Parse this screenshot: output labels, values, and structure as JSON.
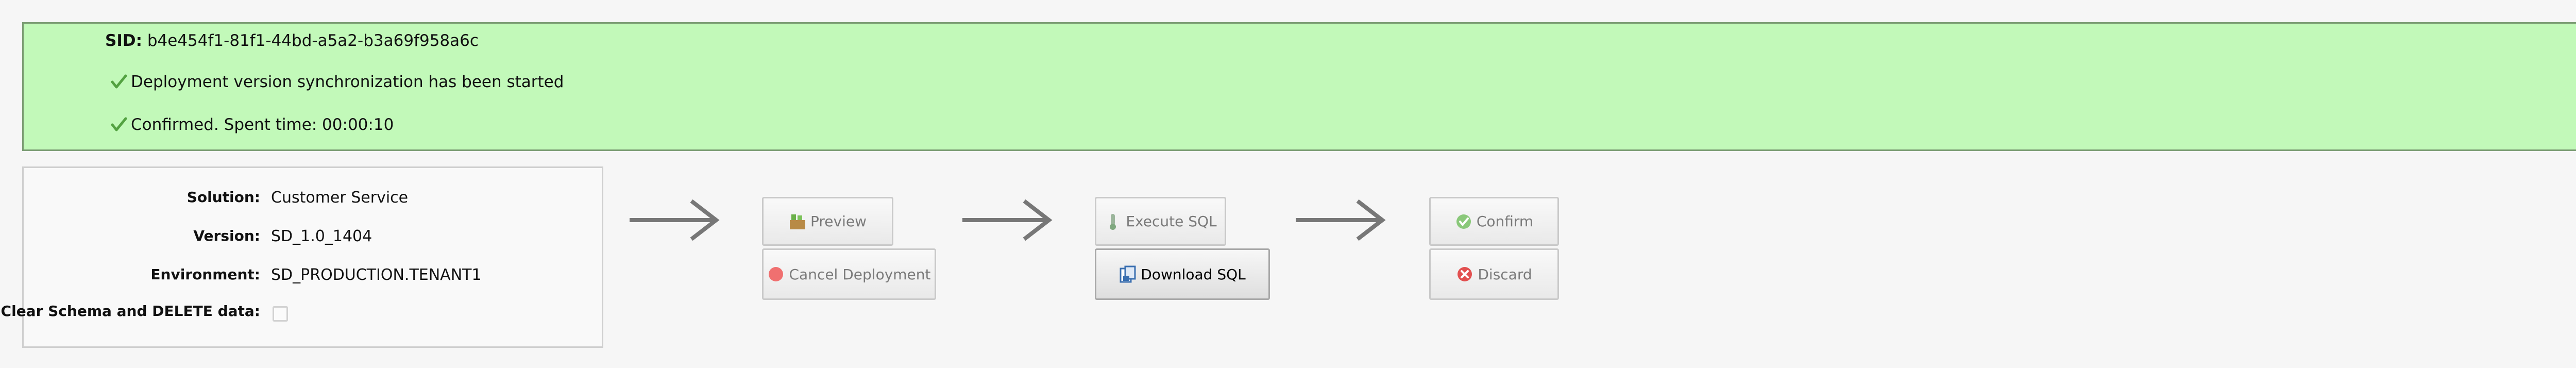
{
  "banner": {
    "sid_label": "SID:",
    "sid_value": "b4e454f1-81f1-44bd-a5a2-b3a69f958a6c",
    "messages": [
      {
        "icon": "check-icon",
        "text": "Deployment version synchronization has been started"
      },
      {
        "icon": "check-icon",
        "text": "Confirmed. Spent time: 00:00:10"
      }
    ],
    "background_color": "#c2f9b9"
  },
  "details": {
    "solution_label": "Solution:",
    "solution_value": "Customer Service",
    "version_label": "Version:",
    "version_value": "SD_1.0_1404",
    "environment_label": "Environment:",
    "environment_value": "SD_PRODUCTION.TENANT1",
    "clear_schema_label": "Clear Schema and DELETE data:",
    "clear_schema_checked": false
  },
  "actions": {
    "preview": {
      "label": "Preview",
      "icon": "preview-icon",
      "enabled": false
    },
    "cancel_deployment": {
      "label": "Cancel Deployment",
      "icon": "cancel-icon",
      "enabled": false
    },
    "execute_sql": {
      "label": "Execute SQL",
      "icon": "thermometer-icon",
      "enabled": false
    },
    "download_sql": {
      "label": "Download SQL",
      "icon": "download-icon",
      "enabled": true
    },
    "confirm": {
      "label": "Confirm",
      "icon": "confirm-check-icon",
      "enabled": false
    },
    "discard": {
      "label": "Discard",
      "icon": "discard-icon",
      "enabled": false
    }
  }
}
